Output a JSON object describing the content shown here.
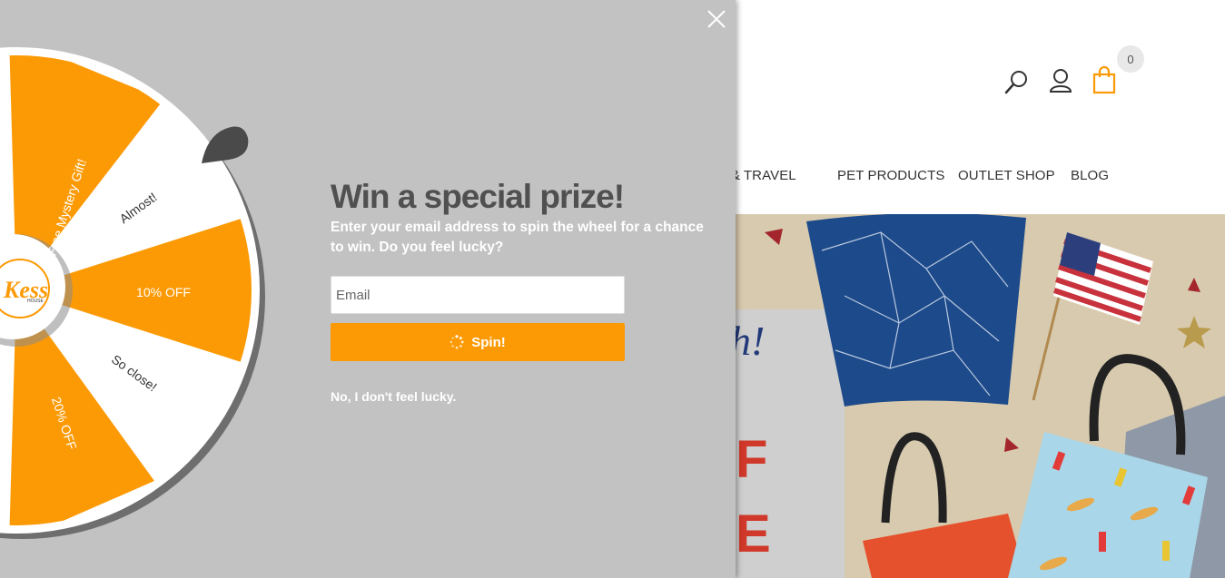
{
  "header": {
    "cart_count": "0",
    "icons": [
      "search-icon",
      "user-icon",
      "shopping-bag-icon"
    ],
    "accent_color": "#fc9a05"
  },
  "nav": {
    "items": [
      "LE & TRAVEL",
      "PET PRODUCTS",
      "OUTLET SHOP",
      "BLOG"
    ]
  },
  "hero": {
    "partial_text": "h!",
    "letters": [
      "F",
      "E"
    ]
  },
  "popup": {
    "title": "Win a special prize!",
    "subtitle": "Enter your email address to spin the wheel for a chance to win. Do you feel lucky?",
    "email_placeholder": "Email",
    "spin_label": "Spin!",
    "decline_label": "No, I don't feel lucky.",
    "button_color": "#fc9a05",
    "background_color": "#c2c2c2"
  },
  "wheel": {
    "segments": [
      "Free Mystery Gift!",
      "Almost!",
      "10% OFF",
      "So close!",
      "20% OFF"
    ],
    "logo_text": "Kess",
    "logo_subtext": "HOUSE",
    "colors": [
      "#fc9a05",
      "#ffffff"
    ]
  }
}
